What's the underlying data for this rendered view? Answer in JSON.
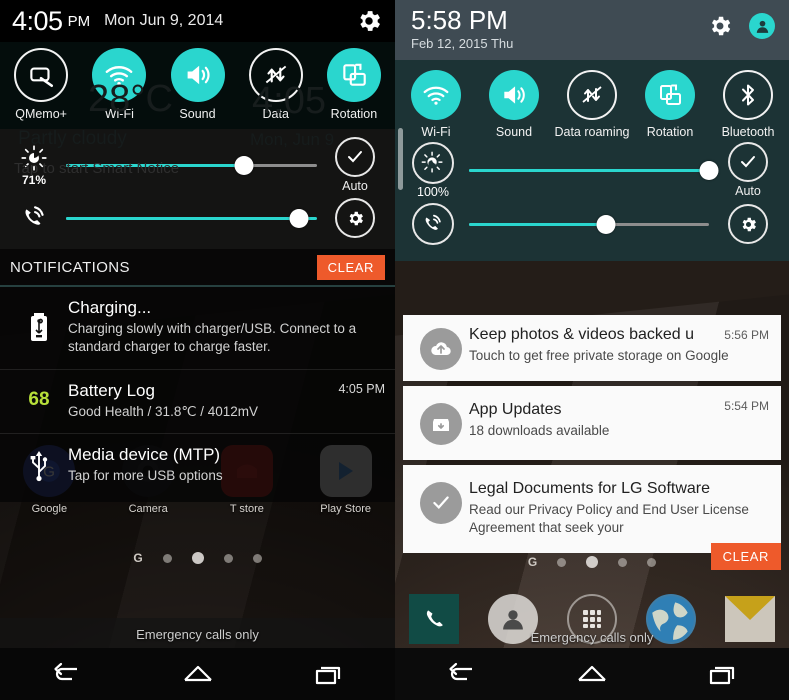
{
  "left_panel": {
    "status": {
      "time": "4:05",
      "ampm": "PM",
      "date": "Mon Jun 9, 2014",
      "settings_icon": "gear-icon"
    },
    "background_widget": {
      "temperature": "28°C",
      "condition": "Partly cloudy",
      "clock": "4:05",
      "clock_date": "Mon, Jun 9",
      "smart_notice_hint": "Tap to start Smart Notice"
    },
    "toggles": [
      {
        "label": "QMemo+",
        "icon": "qmemo-icon",
        "state": "off"
      },
      {
        "label": "Wi-Fi",
        "icon": "wifi-icon",
        "state": "on"
      },
      {
        "label": "Sound",
        "icon": "sound-icon",
        "state": "on"
      },
      {
        "label": "Data",
        "icon": "data-off-icon",
        "state": "off"
      },
      {
        "label": "Rotation",
        "icon": "rotation-icon",
        "state": "on"
      }
    ],
    "brightness": {
      "icon": "brightness-icon",
      "value_label": "71%",
      "percent": 71,
      "auto_label": "Auto",
      "auto_icon": "check-icon"
    },
    "volume": {
      "icon": "ringer-icon",
      "percent": 93,
      "settings_icon": "gear-icon"
    },
    "notifications_header": {
      "title": "NOTIFICATIONS",
      "clear_label": "CLEAR"
    },
    "notifications": [
      {
        "icon": "battery-usb-icon",
        "title": "Charging...",
        "subtitle": "Charging slowly with charger/USB. Connect to a standard charger to charge faster.",
        "time": ""
      },
      {
        "icon": "battery-level-68",
        "badge": "68",
        "title": "Battery Log",
        "subtitle": "Good Health / 31.8℃ / 4012mV",
        "time": "4:05 PM"
      },
      {
        "icon": "usb-icon",
        "title": "Media device (MTP)",
        "subtitle": "Tap for more USB options",
        "time": ""
      }
    ],
    "home": {
      "app_row": [
        {
          "label": "Google",
          "icon": "google-icon"
        },
        {
          "label": "Camera",
          "icon": "camera-icon"
        },
        {
          "label": "T store",
          "icon": "tstore-icon"
        },
        {
          "label": "Play Store",
          "icon": "playstore-icon"
        }
      ],
      "page_dots": {
        "google_mark": "G",
        "count": 4,
        "active_index": 1
      },
      "emergency_text": "Emergency calls only"
    },
    "navbar": [
      {
        "name": "back-button",
        "icon": "back-icon"
      },
      {
        "name": "home-button",
        "icon": "home-icon"
      },
      {
        "name": "recents-button",
        "icon": "recents-icon"
      }
    ]
  },
  "right_panel": {
    "header": {
      "time": "5:58 PM",
      "date": "Feb 12, 2015 Thu",
      "settings_icon": "gear-icon",
      "profile_icon": "user-avatar-icon"
    },
    "toggles": [
      {
        "label": "Wi-Fi",
        "icon": "wifi-icon",
        "state": "on"
      },
      {
        "label": "Sound",
        "icon": "sound-icon",
        "state": "on"
      },
      {
        "label": "Data roaming",
        "icon": "data-off-icon",
        "state": "off"
      },
      {
        "label": "Rotation",
        "icon": "rotation-icon",
        "state": "on"
      },
      {
        "label": "Bluetooth",
        "icon": "bluetooth-icon",
        "state": "off"
      }
    ],
    "brightness": {
      "icon": "brightness-icon",
      "value_label": "100%",
      "percent": 100,
      "auto_label": "Auto",
      "auto_icon": "check-icon"
    },
    "volume": {
      "icon": "ringer-icon",
      "percent": 57,
      "settings_icon": "gear-icon"
    },
    "notifications": [
      {
        "icon": "cloud-upload-icon",
        "title": "Keep photos & videos backed u",
        "subtitle": "Touch to get free private storage on Google",
        "time": "5:56 PM"
      },
      {
        "icon": "app-updates-icon",
        "title": "App Updates",
        "subtitle": "18 downloads available",
        "time": "5:54 PM"
      },
      {
        "icon": "check-icon",
        "title": "Legal Documents for LG Software",
        "subtitle": "Read our Privacy Policy and End User License Agreement that seek your",
        "time": ""
      }
    ],
    "clear_label": "CLEAR",
    "home": {
      "page_dots": {
        "google_mark": "G",
        "count": 4,
        "active_index": 1
      },
      "dock": [
        {
          "label": "Phone",
          "icon": "phone-icon"
        },
        {
          "label": "Contacts",
          "icon": "contacts-icon"
        },
        {
          "label": "Apps",
          "icon": "app-drawer-icon"
        },
        {
          "label": "Browser",
          "icon": "browser-globe-icon"
        },
        {
          "label": "Email",
          "icon": "email-icon"
        }
      ],
      "emergency_text": "Emergency calls only"
    },
    "navbar": [
      {
        "name": "back-button",
        "icon": "back-icon"
      },
      {
        "name": "home-button",
        "icon": "home-icon"
      },
      {
        "name": "recents-button",
        "icon": "recents-icon"
      }
    ]
  },
  "colors": {
    "accent_teal": "#2ad6ce",
    "clear_orange": "#ee5a2b",
    "header_slate": "#3f4b53",
    "quick_settings_dark": "#1c3335",
    "battery_green": "#b7e03a"
  }
}
